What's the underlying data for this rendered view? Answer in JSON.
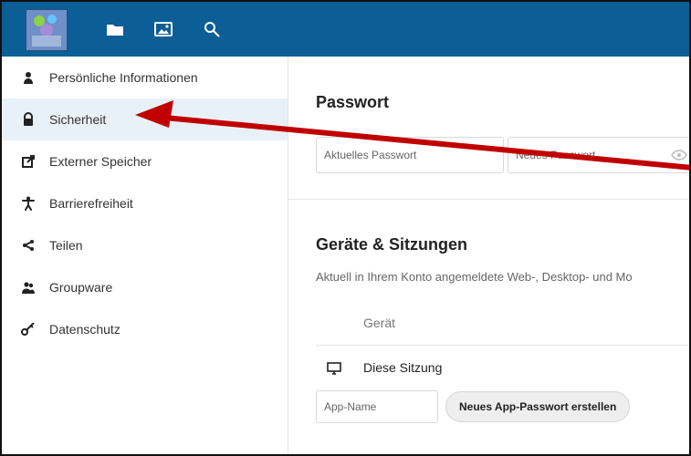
{
  "sidebar": {
    "items": [
      {
        "label": "Persönliche Informationen",
        "icon": "person-icon"
      },
      {
        "label": "Sicherheit",
        "icon": "lock-icon"
      },
      {
        "label": "Externer Speicher",
        "icon": "external-link-icon"
      },
      {
        "label": "Barrierefreiheit",
        "icon": "accessibility-icon"
      },
      {
        "label": "Teilen",
        "icon": "share-icon"
      },
      {
        "label": "Groupware",
        "icon": "groupware-icon"
      },
      {
        "label": "Datenschutz",
        "icon": "key-icon"
      }
    ]
  },
  "passwort": {
    "title": "Passwort",
    "current_placeholder": "Aktuelles Passwort",
    "new_placeholder": "Neues Passwort"
  },
  "sessions": {
    "title": "Geräte & Sitzungen",
    "description": "Aktuell in Ihrem Konto angemeldete Web-, Desktop- und Mo",
    "column_device": "Gerät",
    "row_session": "Diese Sitzung",
    "app_name_placeholder": "App-Name",
    "create_button": "Neues App-Passwort erstellen"
  },
  "colors": {
    "header": "#0b5e96",
    "active_item": "#e9f1f8",
    "annotation_arrow": "#c00000"
  }
}
